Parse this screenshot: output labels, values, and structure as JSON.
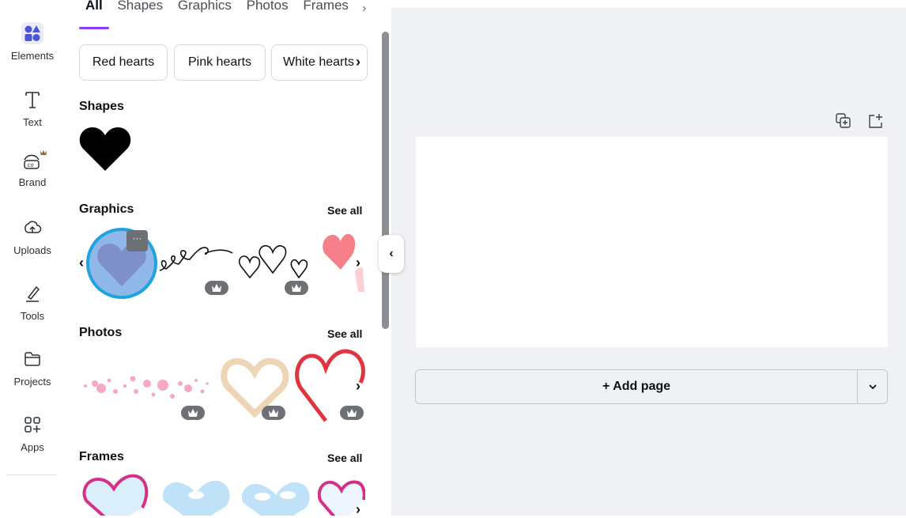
{
  "rail": {
    "items": [
      {
        "label": "Elements",
        "icon": "elements-icon"
      },
      {
        "label": "Text",
        "icon": "text-icon"
      },
      {
        "label": "Brand",
        "icon": "brand-icon"
      },
      {
        "label": "Uploads",
        "icon": "uploads-icon"
      },
      {
        "label": "Tools",
        "icon": "tools-icon"
      },
      {
        "label": "Projects",
        "icon": "projects-icon"
      },
      {
        "label": "Apps",
        "icon": "apps-icon"
      }
    ]
  },
  "panel": {
    "tabs": [
      "All",
      "Shapes",
      "Graphics",
      "Photos",
      "Frames"
    ],
    "chips": [
      "Red hearts",
      "Pink hearts",
      "White hearts"
    ],
    "sections": {
      "shapes": {
        "title": "Shapes"
      },
      "graphics": {
        "title": "Graphics",
        "see_all": "See all"
      },
      "photos": {
        "title": "Photos",
        "see_all": "See all"
      },
      "frames": {
        "title": "Frames",
        "see_all": "See all"
      }
    }
  },
  "canvas": {
    "add_page_label": "+ Add page"
  },
  "colors": {
    "accent": "#8b3dff",
    "selection": "#1fa2e0",
    "workspace_bg": "#f0f1f5"
  }
}
